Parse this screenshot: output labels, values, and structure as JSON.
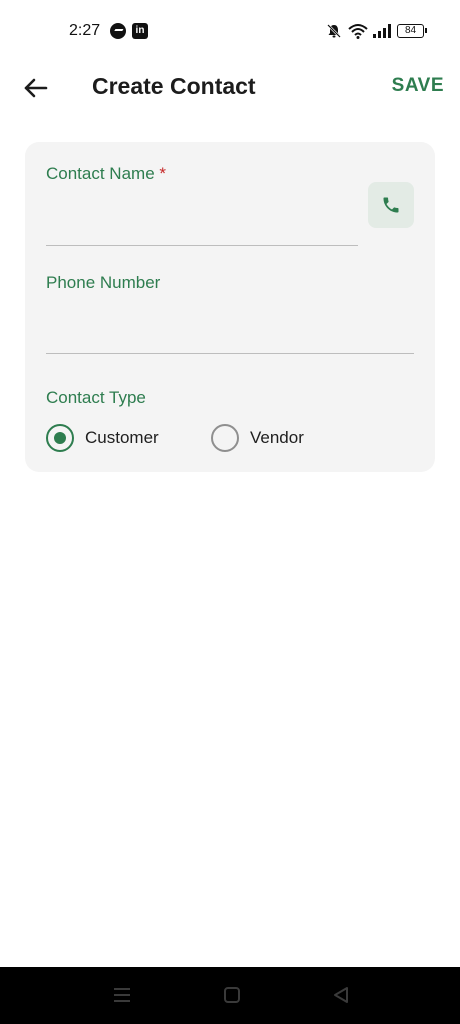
{
  "status_bar": {
    "time": "2:27",
    "battery": "84",
    "icons": [
      "messenger-icon",
      "linkedin-icon",
      "bell-off-icon",
      "wifi-icon",
      "signal-icon",
      "battery-icon"
    ]
  },
  "app_bar": {
    "title": "Create Contact",
    "save_label": "SAVE",
    "back_icon": "arrow-left-icon"
  },
  "form": {
    "contact_name": {
      "label": "Contact Name",
      "required_marker": "*",
      "value": ""
    },
    "phone_number": {
      "label": "Phone Number",
      "value": ""
    },
    "contact_picker_icon": "phone-icon",
    "contact_type": {
      "label": "Contact Type",
      "options": [
        {
          "label": "Customer",
          "selected": true
        },
        {
          "label": "Vendor",
          "selected": false
        }
      ]
    }
  },
  "nav_bar": {
    "buttons": [
      "menu-icon",
      "home-icon",
      "back-triangle-icon"
    ]
  },
  "colors": {
    "accent": "#2e7d4f",
    "required": "#c62828",
    "card_background": "#f4f4f4",
    "navbar": "#000000"
  }
}
